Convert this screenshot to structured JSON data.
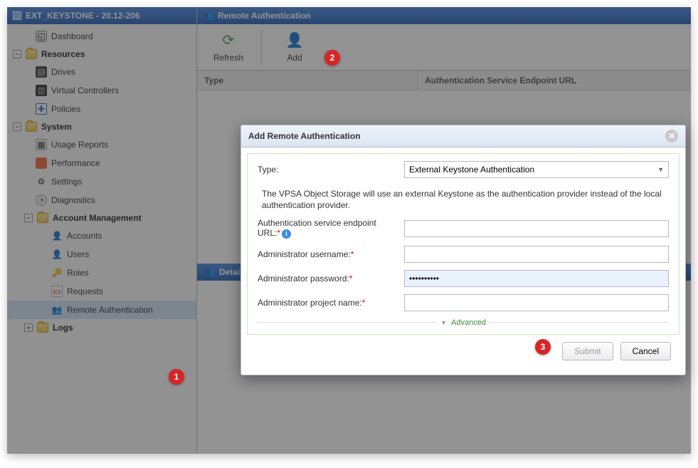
{
  "sidebar": {
    "title": "EXT_KEYSTONE - 20.12-206",
    "dashboard": "Dashboard",
    "groups": {
      "resources": {
        "label": "Resources",
        "drives": "Drives",
        "vc": "Virtual Controllers",
        "policies": "Policies"
      },
      "system": {
        "label": "System",
        "usage": "Usage Reports",
        "perf": "Performance",
        "settings": "Settings",
        "diag": "Diagnostics"
      },
      "acct": {
        "label": "Account Management",
        "accounts": "Accounts",
        "users": "Users",
        "roles": "Roles",
        "requests": "Requests",
        "remote": "Remote Authentication"
      },
      "logs": {
        "label": "Logs"
      }
    }
  },
  "main": {
    "title": "Remote Authentication",
    "toolbar": {
      "refresh": "Refresh",
      "add": "Add"
    },
    "columns": {
      "type": "Type",
      "url": "Authentication Service Endpoint URL"
    },
    "details": "Details"
  },
  "dialog": {
    "title": "Add Remote Authentication",
    "typeLabel": "Type:",
    "typeValue": "External Keystone Authentication",
    "description": "The VPSA Object Storage will use an external Keystone as the authentication provider instead of the local authentication provider.",
    "endpointLabel": "Authentication service endpoint URL:",
    "adminUserLabel": "Administrator username:",
    "adminPwdLabel": "Administrator password:",
    "adminPwdValue": "••••••••••",
    "adminProjLabel": "Administrator project name:",
    "advanced": "Advanced",
    "submit": "Submit",
    "cancel": "Cancel"
  },
  "badges": {
    "b1": "1",
    "b2": "2",
    "b3": "3"
  }
}
